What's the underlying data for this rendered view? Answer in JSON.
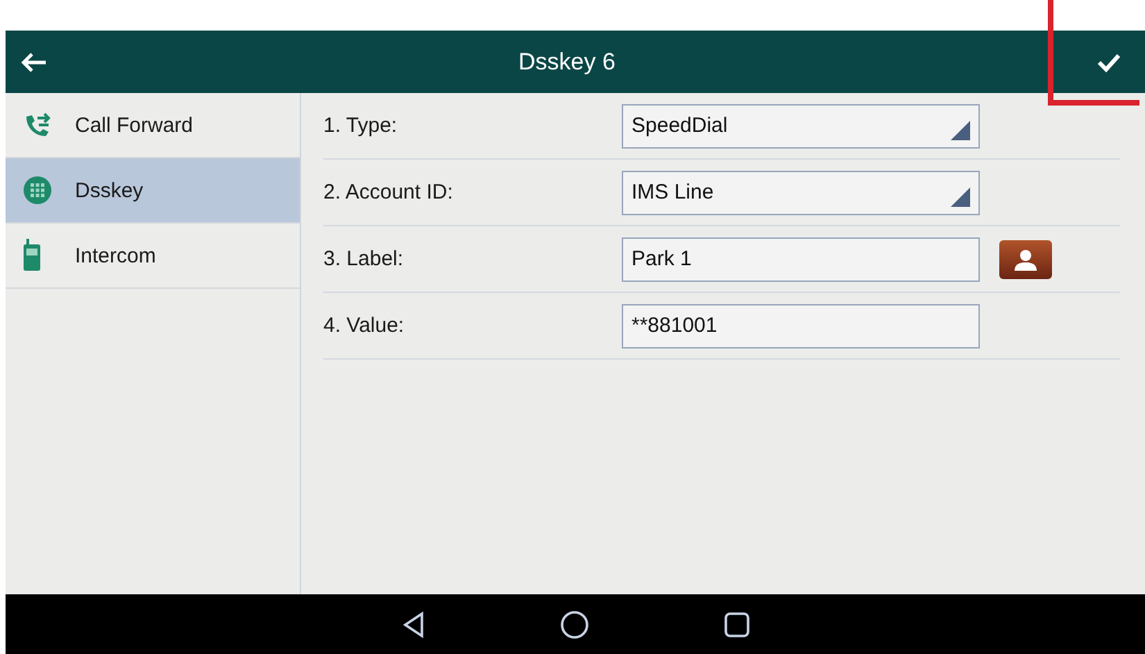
{
  "header": {
    "title": "Dsskey 6"
  },
  "sidebar": {
    "items": [
      {
        "label": "Call Forward",
        "kind": "call-forward",
        "selected": false
      },
      {
        "label": "Dsskey",
        "kind": "keypad",
        "selected": true
      },
      {
        "label": "Intercom",
        "kind": "handset",
        "selected": false
      }
    ]
  },
  "form": {
    "fields": [
      {
        "label": "1. Type:",
        "kind": "dropdown",
        "value": "SpeedDial",
        "contact_button": false
      },
      {
        "label": "2. Account ID:",
        "kind": "dropdown",
        "value": "IMS Line",
        "contact_button": false
      },
      {
        "label": "3. Label:",
        "kind": "text",
        "value": "Park 1",
        "contact_button": true
      },
      {
        "label": "4. Value:",
        "kind": "text",
        "value": "**881001",
        "contact_button": false
      }
    ]
  },
  "annotation": {
    "highlight_save": true
  }
}
